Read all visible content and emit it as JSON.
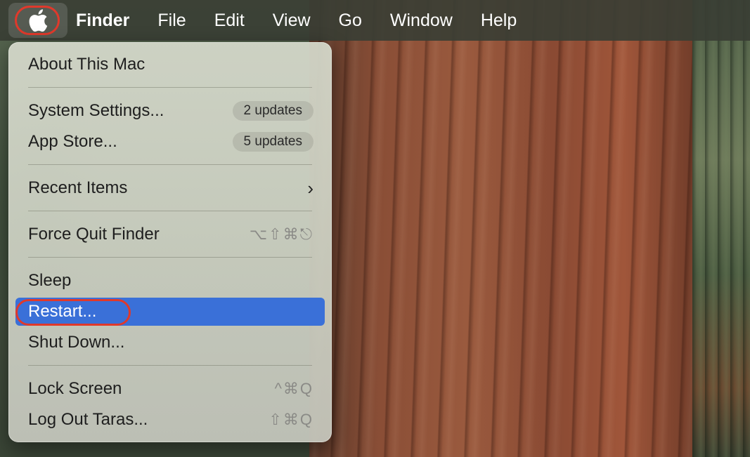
{
  "menubar": {
    "apple_icon": "apple-logo",
    "items": [
      "Finder",
      "File",
      "Edit",
      "View",
      "Go",
      "Window",
      "Help"
    ]
  },
  "apple_menu": {
    "about": "About This Mac",
    "system_settings": {
      "label": "System Settings...",
      "badge": "2 updates"
    },
    "app_store": {
      "label": "App Store...",
      "badge": "5 updates"
    },
    "recent_items": {
      "label": "Recent Items",
      "chevron": "›"
    },
    "force_quit": {
      "label": "Force Quit Finder",
      "shortcut": "⌥⇧⌘⎋"
    },
    "sleep": "Sleep",
    "restart": "Restart...",
    "shut_down": "Shut Down...",
    "lock_screen": {
      "label": "Lock Screen",
      "shortcut": "^⌘Q"
    },
    "log_out": {
      "label": "Log Out Taras...",
      "shortcut": "⇧⌘Q"
    }
  },
  "colors": {
    "selection": "#3a70d8",
    "highlight_ring": "#e0392b"
  }
}
